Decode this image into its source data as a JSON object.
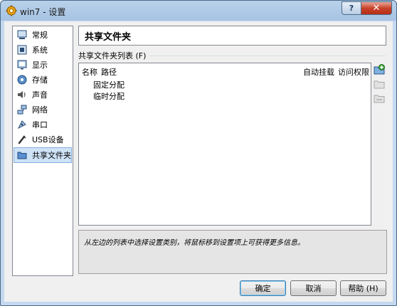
{
  "window": {
    "title": "win7 - 设置",
    "help_symbol": "?",
    "close_symbol": "✕"
  },
  "sidebar": {
    "items": [
      {
        "label": "常规",
        "icon": "general-icon"
      },
      {
        "label": "系统",
        "icon": "system-icon"
      },
      {
        "label": "显示",
        "icon": "display-icon"
      },
      {
        "label": "存储",
        "icon": "storage-icon"
      },
      {
        "label": "声音",
        "icon": "audio-icon"
      },
      {
        "label": "网络",
        "icon": "network-icon"
      },
      {
        "label": "串口",
        "icon": "serial-port-icon"
      },
      {
        "label": "USB设备",
        "icon": "usb-icon"
      },
      {
        "label": "共享文件夹",
        "icon": "shared-folder-icon",
        "selected": true
      }
    ]
  },
  "main": {
    "page_title": "共享文件夹",
    "list_label": "共享文件夹列表 (F)",
    "columns": {
      "name": "名称",
      "path": "路径",
      "auto_mount": "自动挂载",
      "access": "访问权限"
    },
    "rows": [
      "固定分配",
      "临时分配"
    ],
    "info": "从左边的列表中选择设置类别，将鼠标移到设置项上可获得更多信息。"
  },
  "buttons": {
    "ok": "确定",
    "cancel": "取消",
    "help": "帮助 (H)"
  }
}
